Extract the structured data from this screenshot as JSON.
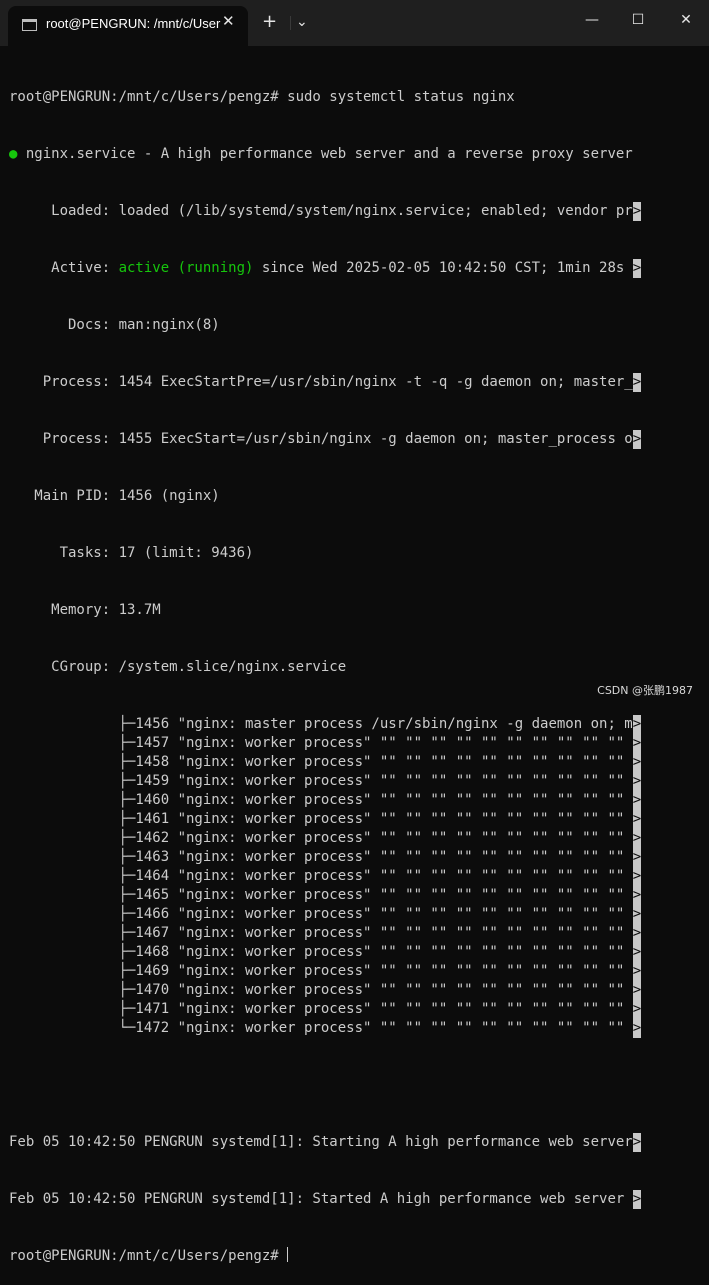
{
  "window": {
    "tab_title": "root@PENGRUN: /mnt/c/User",
    "tab_close": "✕",
    "new_tab": "+",
    "dropdown": "⌄",
    "minimize": "—",
    "maximize": "☐",
    "close": "✕"
  },
  "terminal": {
    "prompt_cmd": "root@PENGRUN:/mnt/c/Users/pengz# sudo systemctl status nginx",
    "service_dot": "●",
    "service_desc": " nginx.service - A high performance web server and a reverse proxy server",
    "loaded": "     Loaded: loaded (/lib/systemd/system/nginx.service; enabled; vendor pr",
    "active_label": "     Active: ",
    "active_state": "active (running)",
    "active_rest": " since Wed 2025-02-05 10:42:50 CST; 1min 28s ",
    "docs": "       Docs: man:nginx(8)",
    "process1": "    Process: 1454 ExecStartPre=/usr/sbin/nginx -t -q -g daemon on; master_",
    "process2": "    Process: 1455 ExecStart=/usr/sbin/nginx -g daemon on; master_process o",
    "main_pid": "   Main PID: 1456 (nginx)",
    "tasks": "      Tasks: 17 (limit: 9436)",
    "memory": "     Memory: 13.7M",
    "cgroup": "     CGroup: /system.slice/nginx.service",
    "cgroup_lines": [
      "             ├─1456 \"nginx: master process /usr/sbin/nginx -g daemon on; m",
      "             ├─1457 \"nginx: worker process\" \"\" \"\" \"\" \"\" \"\" \"\" \"\" \"\" \"\" \"\" ",
      "             ├─1458 \"nginx: worker process\" \"\" \"\" \"\" \"\" \"\" \"\" \"\" \"\" \"\" \"\" ",
      "             ├─1459 \"nginx: worker process\" \"\" \"\" \"\" \"\" \"\" \"\" \"\" \"\" \"\" \"\" ",
      "             ├─1460 \"nginx: worker process\" \"\" \"\" \"\" \"\" \"\" \"\" \"\" \"\" \"\" \"\" ",
      "             ├─1461 \"nginx: worker process\" \"\" \"\" \"\" \"\" \"\" \"\" \"\" \"\" \"\" \"\" ",
      "             ├─1462 \"nginx: worker process\" \"\" \"\" \"\" \"\" \"\" \"\" \"\" \"\" \"\" \"\" ",
      "             ├─1463 \"nginx: worker process\" \"\" \"\" \"\" \"\" \"\" \"\" \"\" \"\" \"\" \"\" ",
      "             ├─1464 \"nginx: worker process\" \"\" \"\" \"\" \"\" \"\" \"\" \"\" \"\" \"\" \"\" ",
      "             ├─1465 \"nginx: worker process\" \"\" \"\" \"\" \"\" \"\" \"\" \"\" \"\" \"\" \"\" ",
      "             ├─1466 \"nginx: worker process\" \"\" \"\" \"\" \"\" \"\" \"\" \"\" \"\" \"\" \"\" ",
      "             ├─1467 \"nginx: worker process\" \"\" \"\" \"\" \"\" \"\" \"\" \"\" \"\" \"\" \"\" ",
      "             ├─1468 \"nginx: worker process\" \"\" \"\" \"\" \"\" \"\" \"\" \"\" \"\" \"\" \"\" ",
      "             ├─1469 \"nginx: worker process\" \"\" \"\" \"\" \"\" \"\" \"\" \"\" \"\" \"\" \"\" ",
      "             ├─1470 \"nginx: worker process\" \"\" \"\" \"\" \"\" \"\" \"\" \"\" \"\" \"\" \"\" ",
      "             ├─1471 \"nginx: worker process\" \"\" \"\" \"\" \"\" \"\" \"\" \"\" \"\" \"\" \"\" ",
      "             └─1472 \"nginx: worker process\" \"\" \"\" \"\" \"\" \"\" \"\" \"\" \"\" \"\" \"\" "
    ],
    "trunc_marker": ">",
    "log1": "Feb 05 10:42:50 PENGRUN systemd[1]: Starting A high performance web server",
    "log2": "Feb 05 10:42:50 PENGRUN systemd[1]: Started A high performance web server ",
    "prompt_end": "root@PENGRUN:/mnt/c/Users/pengz# "
  },
  "watermark": "CSDN @张鹏1987"
}
